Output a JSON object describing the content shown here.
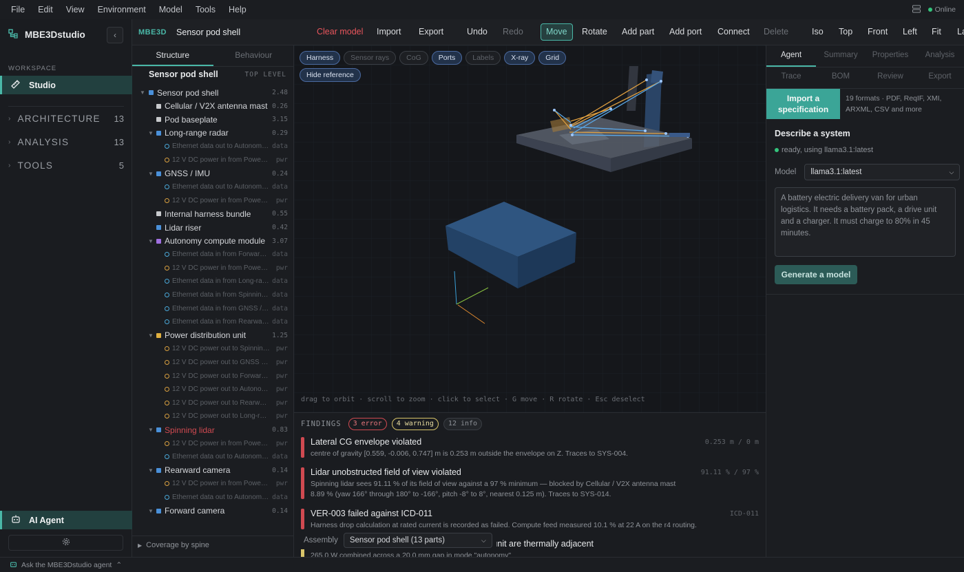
{
  "menubar": {
    "items": [
      "File",
      "Edit",
      "View",
      "Environment",
      "Model",
      "Tools",
      "Help"
    ],
    "status": "Online"
  },
  "sidebar": {
    "brand": "MBE3Dstudio",
    "workspace_label": "WORKSPACE",
    "studio_label": "Studio",
    "sections": [
      {
        "label": "ARCHITECTURE",
        "count": "13"
      },
      {
        "label": "ANALYSIS",
        "count": "13"
      },
      {
        "label": "TOOLS",
        "count": "5"
      }
    ],
    "ai_agent_label": "AI Agent"
  },
  "toolbar": {
    "tag": "MBE3D",
    "model_title": "Sensor pod shell",
    "buttons": [
      "Clear model",
      "Import",
      "Export",
      "Undo",
      "Redo",
      "Move",
      "Rotate",
      "Add part",
      "Add port",
      "Connect",
      "Delete",
      "Iso",
      "Top",
      "Front",
      "Left",
      "Fit",
      "La"
    ]
  },
  "tree": {
    "tabs": [
      "Structure",
      "Behaviour"
    ],
    "root_title": "Sensor pod shell",
    "root_level": "TOP LEVEL",
    "rows": [
      {
        "label": "Sensor pod shell",
        "value": "2.48"
      },
      {
        "label": "Cellular / V2X antenna mast",
        "value": "0.26"
      },
      {
        "label": "Pod baseplate",
        "value": "3.15"
      },
      {
        "label": "Long-range radar",
        "value": "0.29"
      },
      {
        "label": "Ethernet data out to Autonomy compute module",
        "value": "data"
      },
      {
        "label": "12 V DC power in from Power distribution unit",
        "value": "pwr"
      },
      {
        "label": "GNSS / IMU",
        "value": "0.24"
      },
      {
        "label": "Ethernet data out to Autonomy compute module",
        "value": "data"
      },
      {
        "label": "12 V DC power in from Power distribution unit",
        "value": "pwr"
      },
      {
        "label": "Internal harness bundle",
        "value": "0.55"
      },
      {
        "label": "Lidar riser",
        "value": "0.42"
      },
      {
        "label": "Autonomy compute module",
        "value": "3.07"
      },
      {
        "label": "Ethernet data in from Forward camera",
        "value": "data"
      },
      {
        "label": "12 V DC power in from Power distribution unit",
        "value": "pwr"
      },
      {
        "label": "Ethernet data in from Long-range radar",
        "value": "data"
      },
      {
        "label": "Ethernet data in from Spinning lidar",
        "value": "data"
      },
      {
        "label": "Ethernet data in from GNSS / IMU",
        "value": "data"
      },
      {
        "label": "Ethernet data in from Rearward camera",
        "value": "data"
      },
      {
        "label": "Power distribution unit",
        "value": "1.25"
      },
      {
        "label": "12 V DC power out to Spinning lidar",
        "value": "pwr"
      },
      {
        "label": "12 V DC power out to GNSS / IMU",
        "value": "pwr"
      },
      {
        "label": "12 V DC power out to Forward camera",
        "value": "pwr"
      },
      {
        "label": "12 V DC power out to Autonomy compute module",
        "value": "pwr"
      },
      {
        "label": "12 V DC power out to Rearward camera",
        "value": "pwr"
      },
      {
        "label": "12 V DC power out to Long-range radar",
        "value": "pwr"
      },
      {
        "label": "Spinning lidar",
        "value": "0.83"
      },
      {
        "label": "12 V DC power in from Power distribution unit",
        "value": "pwr"
      },
      {
        "label": "Ethernet data out to Autonomy compute module",
        "value": "data"
      },
      {
        "label": "Rearward camera",
        "value": "0.14"
      },
      {
        "label": "12 V DC power in from Power distribution unit",
        "value": "pwr"
      },
      {
        "label": "Ethernet data out to Autonomy compute module",
        "value": "data"
      },
      {
        "label": "Forward camera",
        "value": "0.14"
      }
    ],
    "coverage_label": "Coverage by spine"
  },
  "viewport": {
    "chips": [
      "Harness",
      "Sensor rays",
      "CoG",
      "Ports",
      "Labels",
      "X-ray",
      "Grid",
      "Hide reference"
    ],
    "chips_on": [
      true,
      false,
      false,
      true,
      false,
      true,
      true,
      true
    ],
    "hint": "drag to orbit · scroll to zoom · click to select · G move · R rotate · Esc deselect"
  },
  "findings": {
    "label": "FINDINGS",
    "counts": {
      "error": "3 error",
      "warning": "4 warning",
      "info": "12 info"
    },
    "items": [
      {
        "title": "Lateral CG envelope violated",
        "desc": [
          "centre of gravity [0.559, -0.006, 0.747] m is 0.253 m outside the envelope on Z. Traces to SYS-004."
        ],
        "metric": "0.253 m / 0 m"
      },
      {
        "title": "Lidar unobstructed field of view violated",
        "desc": [
          "Spinning lidar sees 91.11 % of its field of view against a 97 % minimum — blocked by Cellular / V2X antenna mast",
          "8.89 % (yaw 166° through 180° to -166°, pitch -8° to 8°, nearest 0.125 m). Traces to SYS-014."
        ],
        "metric": "91.11 % / 97 %"
      },
      {
        "title": "VER-003 failed against ICD-011",
        "desc": [
          "Harness drop calculation at rated current is recorded as failed. Compute feed measured 10.1 % at 22 A on the r4 routing."
        ],
        "metric": "ICD-011"
      },
      {
        "title": "n unit are thermally adjacent",
        "desc": [
          "265.0 W combined across a 20.0 mm gap in mode \"autonomy\""
        ],
        "metric": ""
      }
    ],
    "assembly_label": "Assembly",
    "assembly_value": "Sensor pod shell (13 parts)"
  },
  "right": {
    "tabs": [
      "Agent",
      "Summary",
      "Properties",
      "Analysis",
      "Trace",
      "BOM",
      "Review",
      "Export"
    ],
    "import_label": "Import a specification",
    "formats": "19 formats · PDF, ReqIF, XMI, ARXML, CSV and more",
    "describe_title": "Describe a system",
    "ready": "ready, using llama3.1:latest",
    "model_label": "Model",
    "model_value": "llama3.1:latest",
    "prompt": "A battery electric delivery van for urban logistics. It needs a battery pack, a drive unit and a charger. It must charge to 80% in 45 minutes.",
    "generate_label": "Generate a model"
  },
  "statusbar": {
    "ask": "Ask the MBE3Dstudio agent"
  },
  "colors": {
    "accent": "#4ab8a8",
    "error": "#d04a51",
    "warning": "#d9c56a",
    "online": "#34c47c",
    "part_blue": "#4a90d9",
    "part_purple": "#a070e0",
    "part_yellow": "#e0b040",
    "part_gray": "#c8cacd",
    "port_data": "#4aa8d9",
    "port_pwr": "#d9a040"
  },
  "icons": [
    "layers-icon",
    "brand-icon",
    "chevron-left-icon",
    "ruler-icon",
    "chevron-right-icon",
    "robot-icon",
    "gear-icon",
    "chevron-up-icon",
    "caret-down-icon"
  ]
}
